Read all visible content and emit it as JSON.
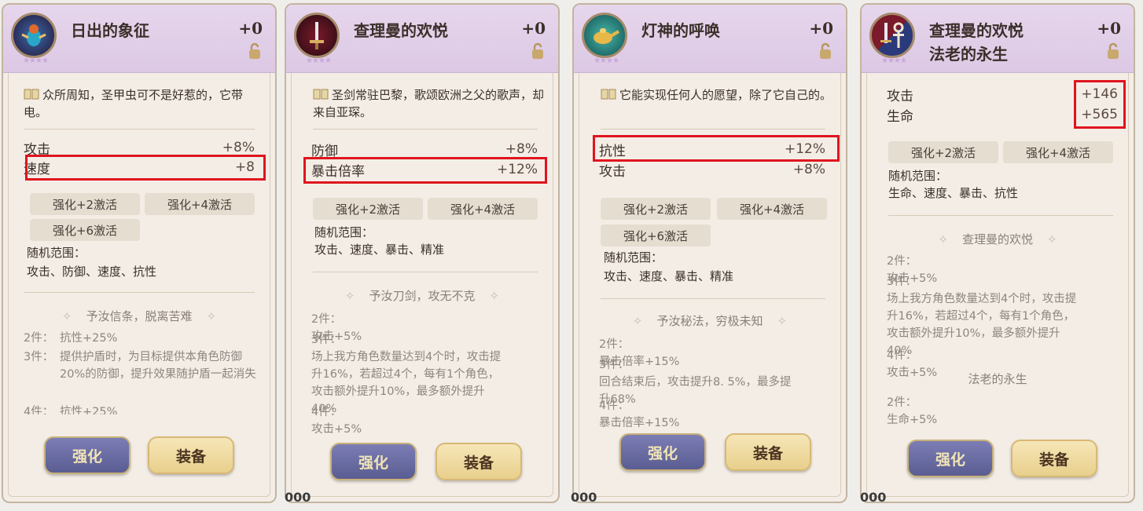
{
  "colors": {
    "highlight": "#e0141e",
    "header_bg": "#dcc8e4",
    "card_bg": "#f3ede6",
    "enhance_btn": "#5a5d92",
    "equip_btn": "#e8cf8c"
  },
  "cards": [
    {
      "emblem_icon": "scarab-icon",
      "stars": "★★★★",
      "title1": "日出的象征",
      "title2": "",
      "plus": "+0",
      "desc": "众所周知，圣甲虫可不是好惹的，它带电。",
      "stats": [
        {
          "name": "攻击",
          "value": "+8%"
        },
        {
          "name": "速度",
          "value": "+8"
        }
      ],
      "chips": [
        "强化+2激活",
        "强化+4激活",
        "强化+6激活"
      ],
      "random_label": "随机范围：",
      "random_values": "攻击、防御、速度、抗性",
      "set_title": "予汝信条，脱离苦难",
      "set_lines": [
        {
          "k": "2件：",
          "v": "抗性+25%"
        },
        {
          "k": "3件：",
          "v": "提供护盾时，为目标提供本角色防御20%的防御，提升效果随护盾一起消失"
        },
        {
          "k": "4件：",
          "v": "抗性+25%"
        }
      ],
      "enhance": "强化",
      "equip": "装备"
    },
    {
      "emblem_icon": "sword-icon",
      "stars": "★★★★",
      "title1": "查理曼的欢悦",
      "title2": "",
      "plus": "+0",
      "desc": "圣剑常驻巴黎，歌颂欧洲之父的歌声，却来自亚琛。",
      "stats": [
        {
          "name": "防御",
          "value": "+8%"
        },
        {
          "name": "暴击倍率",
          "value": "+12%"
        }
      ],
      "chips": [
        "强化+2激活",
        "强化+4激活"
      ],
      "random_label": "随机范围：",
      "random_values": "攻击、速度、暴击、精准",
      "set_title": "予汝刀剑，攻无不克",
      "set_lines": [
        {
          "k": "2件：",
          "v": "攻击+5%"
        },
        {
          "k": "3件：",
          "v": "场上我方角色数量达到4个时，攻击提升16%，若超过4个，每有1个角色，攻击额外提升10%，最多额外提升40%"
        },
        {
          "k": "4件：",
          "v": "攻击+5%"
        }
      ],
      "enhance": "强化",
      "equip": "装备"
    },
    {
      "emblem_icon": "lamp-icon",
      "stars": "★★★★",
      "title1": "灯神的呼唤",
      "title2": "",
      "plus": "+0",
      "desc": "它能实现任何人的愿望，除了它自己的。",
      "stats": [
        {
          "name": "抗性",
          "value": "+12%"
        },
        {
          "name": "攻击",
          "value": "+8%"
        }
      ],
      "chips": [
        "强化+2激活",
        "强化+4激活",
        "强化+6激活"
      ],
      "random_label": "随机范围：",
      "random_values": "攻击、速度、暴击、精准",
      "set_title": "予汝秘法，穷极未知",
      "set_lines": [
        {
          "k": "2件：",
          "v": "暴击倍率+15%"
        },
        {
          "k": "3件：",
          "v": "回合结束后，攻击提升8. 5%，最多提升68%"
        },
        {
          "k": "4件：",
          "v": "暴击倍率+15%"
        }
      ],
      "enhance": "强化",
      "equip": "装备"
    },
    {
      "emblem_icon": "sword-ankh-icon",
      "stars": "★★★★",
      "title1": "查理曼的欢悦",
      "title2": "法老的永生",
      "plus": "+0",
      "desc": "",
      "stats": [
        {
          "name": "攻击",
          "value": "+146"
        },
        {
          "name": "生命",
          "value": "+565"
        }
      ],
      "chips": [
        "强化+2激活",
        "强化+4激活"
      ],
      "random_label": "随机范围：",
      "random_values": "生命、速度、暴击、抗性",
      "set_title": "查理曼的欢悦",
      "set_lines": [
        {
          "k": "2件：",
          "v": "攻击+5%"
        },
        {
          "k": "3件：",
          "v": "场上我方角色数量达到4个时，攻击提升16%，若超过4个，每有1个角色，攻击额外提升10%，最多额外提升40%"
        },
        {
          "k": "4件：",
          "v": "攻击+5%"
        }
      ],
      "set_title2": "法老的永生",
      "set_lines2": [
        {
          "k": "2件：",
          "v": "生命+5%"
        }
      ],
      "enhance": "强化",
      "equip": "装备"
    }
  ],
  "bottom_text": "000"
}
